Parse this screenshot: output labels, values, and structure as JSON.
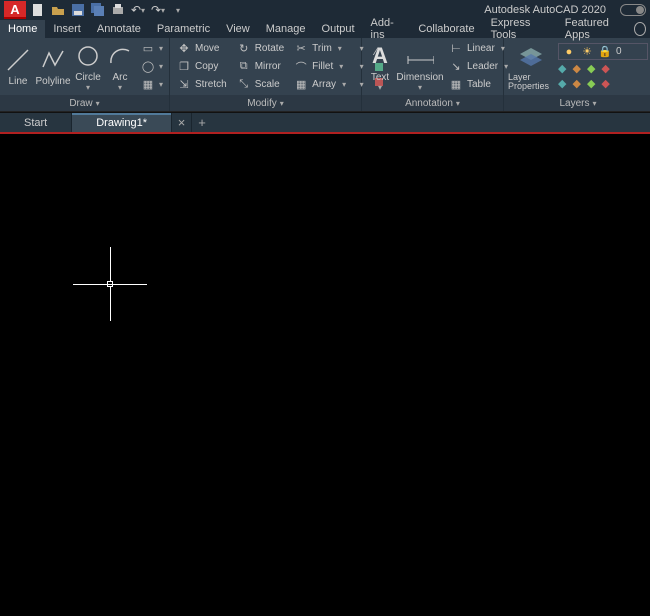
{
  "app": {
    "title": "Autodesk AutoCAD 2020",
    "logo_letter": "A"
  },
  "qat": [
    "new",
    "open",
    "save",
    "saveall",
    "plot",
    "undo",
    "redo"
  ],
  "menu": {
    "items": [
      "Home",
      "Insert",
      "Annotate",
      "Parametric",
      "View",
      "Manage",
      "Output",
      "Add-ins",
      "Collaborate",
      "Express Tools",
      "Featured Apps"
    ],
    "active": "Home"
  },
  "ribbon": {
    "draw": {
      "label": "Draw",
      "tools": [
        {
          "id": "line",
          "label": "Line"
        },
        {
          "id": "polyline",
          "label": "Polyline"
        },
        {
          "id": "circle",
          "label": "Circle"
        },
        {
          "id": "arc",
          "label": "Arc"
        }
      ]
    },
    "modify": {
      "label": "Modify",
      "col1": [
        {
          "icon": "move-icon",
          "label": "Move"
        },
        {
          "icon": "copy-icon",
          "label": "Copy"
        },
        {
          "icon": "stretch-icon",
          "label": "Stretch"
        }
      ],
      "col2": [
        {
          "icon": "rotate-icon",
          "label": "Rotate"
        },
        {
          "icon": "mirror-icon",
          "label": "Mirror"
        },
        {
          "icon": "scale-icon",
          "label": "Scale"
        }
      ],
      "col3": [
        {
          "icon": "trim-icon",
          "label": "Trim"
        },
        {
          "icon": "fillet-icon",
          "label": "Fillet"
        },
        {
          "icon": "array-icon",
          "label": "Array"
        }
      ]
    },
    "annotation": {
      "label": "Annotation",
      "text": "Text",
      "dimension": "Dimension",
      "rows": [
        {
          "icon": "linear-icon",
          "label": "Linear"
        },
        {
          "icon": "leader-icon",
          "label": "Leader"
        },
        {
          "icon": "table-icon",
          "label": "Table"
        }
      ]
    },
    "layers": {
      "label": "Layers",
      "big": "Layer Properties",
      "current_layer": "0"
    }
  },
  "tabs": {
    "start": "Start",
    "current": "Drawing1*"
  }
}
